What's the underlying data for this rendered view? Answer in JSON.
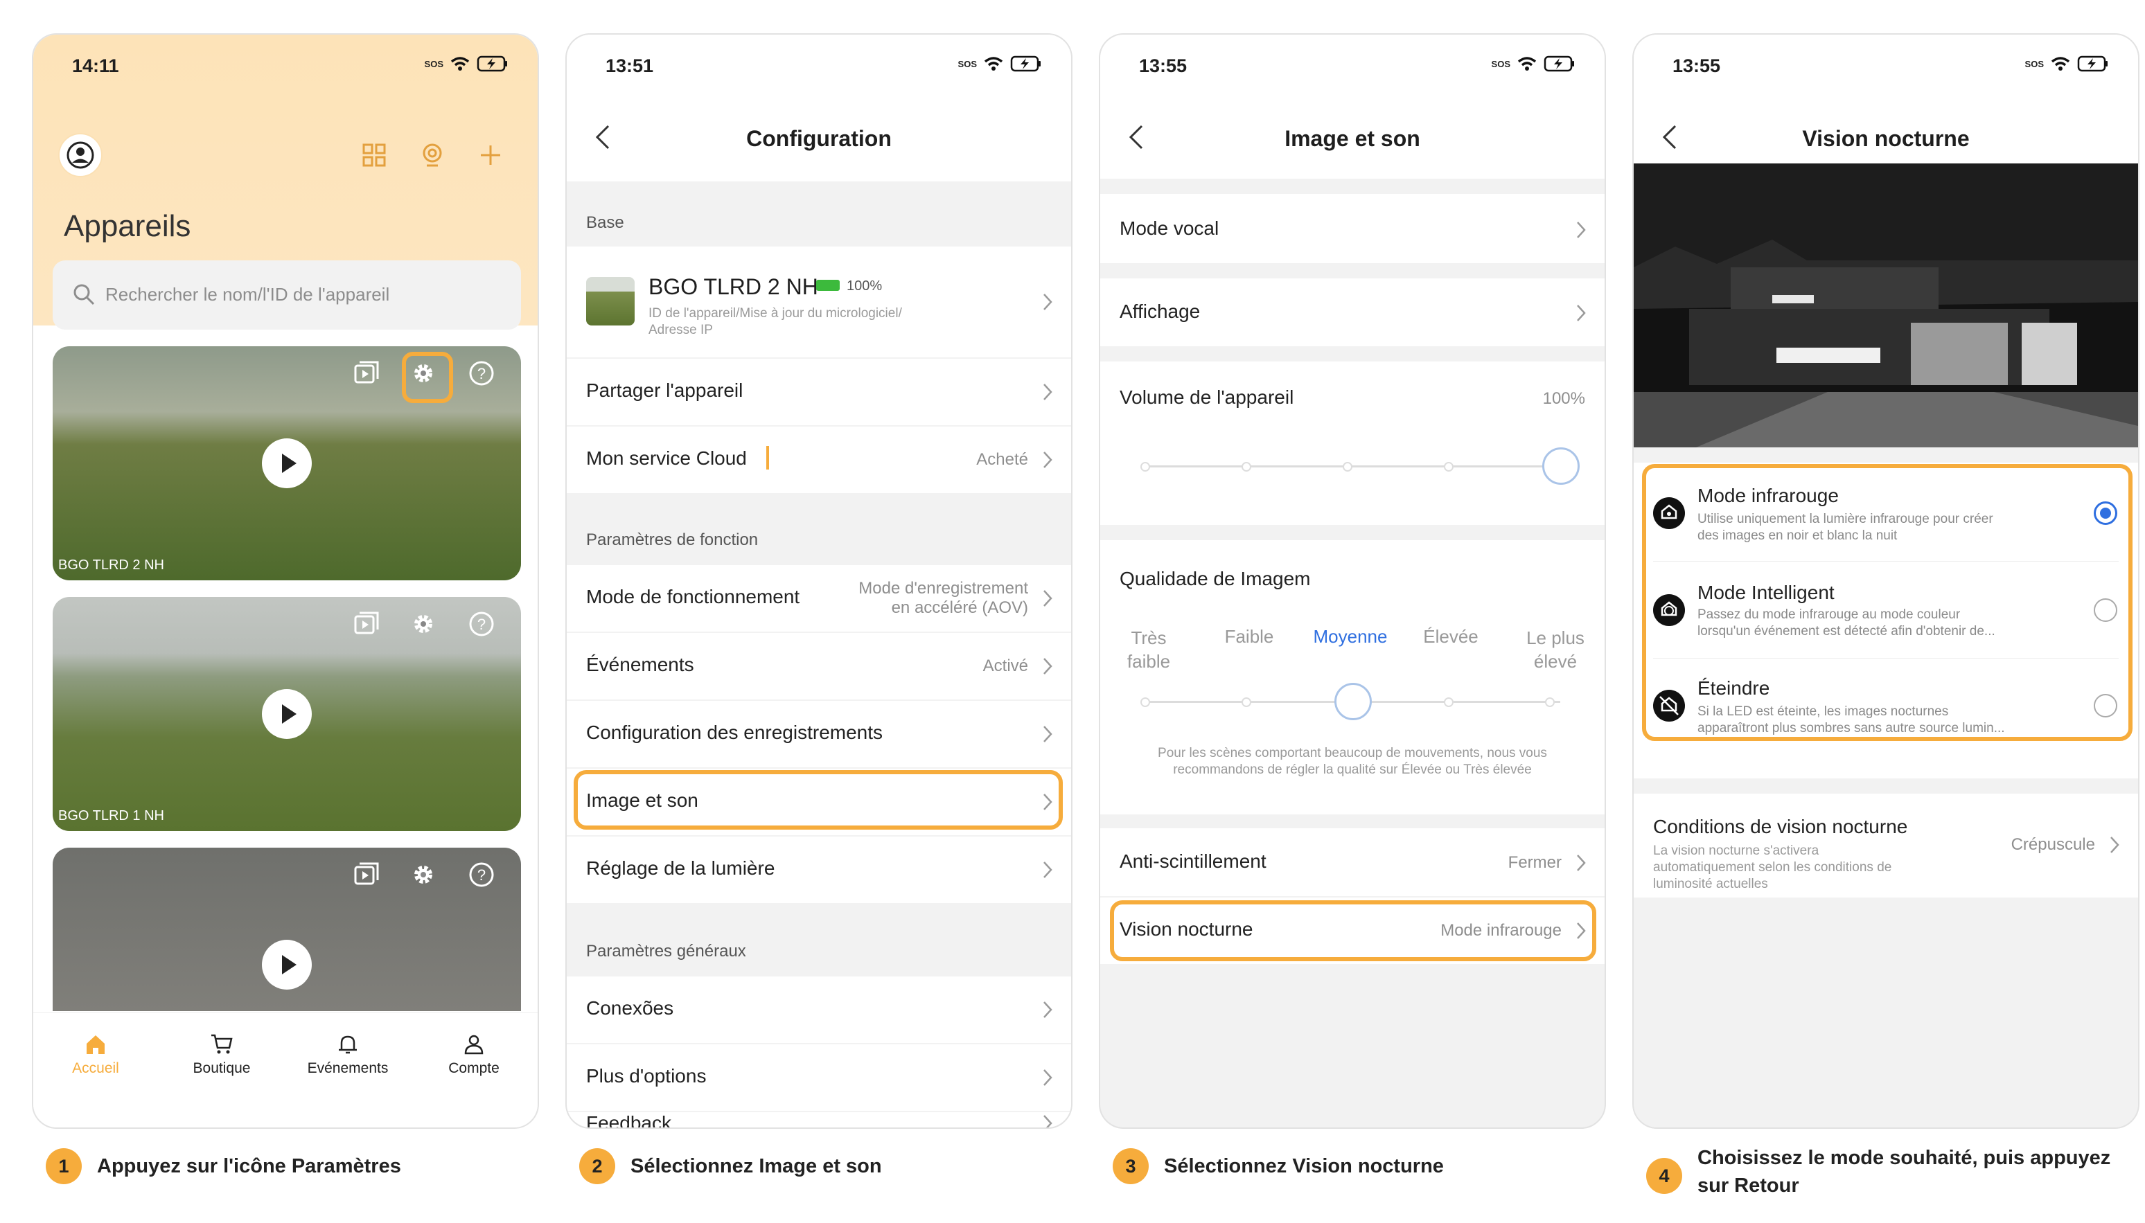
{
  "colors": {
    "accent": "#f6ac3c",
    "link_blue": "#2f6fe0"
  },
  "screens": {
    "home": {
      "time": "14:11",
      "sos": "SOS",
      "title": "Appareils",
      "search_placeholder": "Rechercher le nom/l'ID de l'appareil",
      "cameras": [
        {
          "name": "BGO TLRD 2 NH"
        },
        {
          "name": "BGO TLRD 1 NH"
        },
        {
          "name": ""
        }
      ],
      "tabs": [
        {
          "label": "Accueil",
          "icon": "home-icon"
        },
        {
          "label": "Boutique",
          "icon": "cart-icon"
        },
        {
          "label": "Evénements",
          "icon": "bell-icon"
        },
        {
          "label": "Compte",
          "icon": "user-icon"
        }
      ]
    },
    "config": {
      "time": "13:51",
      "sos": "SOS",
      "title": "Configuration",
      "section_base": "Base",
      "device_name": "BGO TLRD 2 NH",
      "battery": "100%",
      "device_sub1": "ID de l'appareil/Mise à jour du micrologiciel/",
      "device_sub2": "Adresse IP",
      "share": "Partager l'appareil",
      "cloud": "Mon service Cloud",
      "cloud_value": "Acheté",
      "section_function": "Paramètres de fonction",
      "mode": "Mode de fonctionnement",
      "mode_value1": "Mode d'enregistrement",
      "mode_value2": "en accéléré (AOV)",
      "events": "Événements",
      "events_value": "Activé",
      "recording": "Configuration des enregistrements",
      "image_sound": "Image et son",
      "light": "Réglage de la lumière",
      "section_general": "Paramètres généraux",
      "connections": "Conexões",
      "more": "Plus d'options",
      "feedback": "Feedback"
    },
    "image": {
      "time": "13:55",
      "sos": "SOS",
      "title": "Image et son",
      "voice": "Mode vocal",
      "display": "Affichage",
      "volume": "Volume de l'appareil",
      "volume_value": "100%",
      "quality": "Qualidade de Imagem",
      "levels": [
        "Très faible",
        "Faible",
        "Moyenne",
        "Élevée",
        "Le plus élevé"
      ],
      "selected_level": "Moyenne",
      "quality_note": "Pour les scènes comportant beaucoup de mouvements, nous vous recommandons de régler la qualité sur Élevée ou Très élevée",
      "flicker": "Anti-scintillement",
      "flicker_value": "Fermer",
      "night": "Vision nocturne",
      "night_value": "Mode infrarouge"
    },
    "night": {
      "time": "13:55",
      "sos": "SOS",
      "title": "Vision nocturne",
      "modes": [
        {
          "title": "Mode infrarouge",
          "desc1": "Utilise uniquement la lumière infrarouge pour créer",
          "desc2": "des images en noir et blanc la nuit",
          "selected": true
        },
        {
          "title": "Mode Intelligent",
          "desc1": "Passez du mode infrarouge au mode couleur",
          "desc2": "lorsqu'un événement est détecté afin d'obtenir de...",
          "selected": false
        },
        {
          "title": "Éteindre",
          "desc1": "Si la LED est éteinte, les images nocturnes",
          "desc2": "apparaîtront plus sombres sans autre source lumin...",
          "selected": false
        }
      ],
      "conditions": "Conditions de vision nocturne",
      "conditions_desc1": "La vision nocturne s'activera",
      "conditions_desc2": "automatiquement selon les conditions de",
      "conditions_desc3": "luminosité actuelles",
      "conditions_value": "Crépuscule"
    }
  },
  "steps": [
    {
      "num": "1",
      "text": "Appuyez sur l'icône Paramètres"
    },
    {
      "num": "2",
      "text": "Sélectionnez Image et son"
    },
    {
      "num": "3",
      "text": "Sélectionnez Vision nocturne"
    },
    {
      "num": "4",
      "text1": "Choisissez le mode souhaité, puis appuyez",
      "text2": "sur Retour"
    }
  ]
}
